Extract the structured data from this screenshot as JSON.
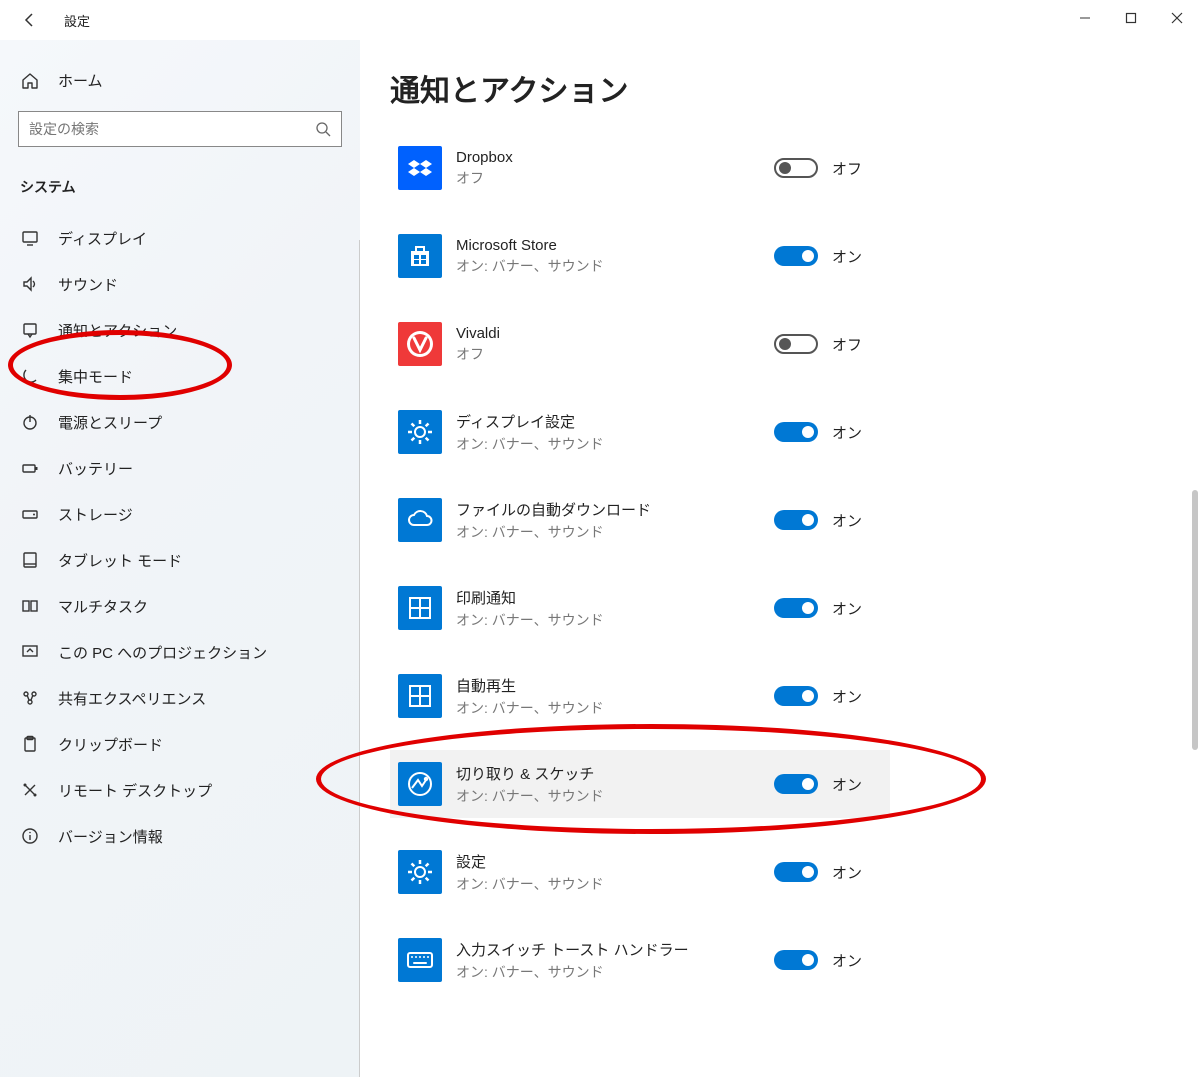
{
  "window": {
    "title": "設定"
  },
  "sidebar": {
    "home": "ホーム",
    "search_placeholder": "設定の検索",
    "section": "システム",
    "items": [
      {
        "icon": "display",
        "label": "ディスプレイ"
      },
      {
        "icon": "sound",
        "label": "サウンド"
      },
      {
        "icon": "notification",
        "label": "通知とアクション"
      },
      {
        "icon": "focus",
        "label": "集中モード"
      },
      {
        "icon": "power",
        "label": "電源とスリープ"
      },
      {
        "icon": "battery",
        "label": "バッテリー"
      },
      {
        "icon": "storage",
        "label": "ストレージ"
      },
      {
        "icon": "tablet",
        "label": "タブレット モード"
      },
      {
        "icon": "multitask",
        "label": "マルチタスク"
      },
      {
        "icon": "project",
        "label": "この PC へのプロジェクション"
      },
      {
        "icon": "share",
        "label": "共有エクスペリエンス"
      },
      {
        "icon": "clipboard",
        "label": "クリップボード"
      },
      {
        "icon": "remote",
        "label": "リモート デスクトップ"
      },
      {
        "icon": "about",
        "label": "バージョン情報"
      }
    ]
  },
  "page": {
    "title": "通知とアクション",
    "on_label": "オン",
    "off_label": "オフ",
    "status_on": "オン: バナー、サウンド",
    "status_off": "オフ",
    "apps": [
      {
        "icon": "dropbox",
        "bg": "#0061fe",
        "name": "Dropbox",
        "on": false,
        "highlighted": false
      },
      {
        "icon": "store",
        "bg": "#0078d4",
        "name": "Microsoft Store",
        "on": true,
        "highlighted": false
      },
      {
        "icon": "vivaldi",
        "bg": "#ef3939",
        "name": "Vivaldi",
        "on": false,
        "highlighted": false
      },
      {
        "icon": "gear",
        "bg": "#0078d4",
        "name": "ディスプレイ設定",
        "on": true,
        "highlighted": false
      },
      {
        "icon": "cloud",
        "bg": "#0078d4",
        "name": "ファイルの自動ダウンロード",
        "on": true,
        "highlighted": false
      },
      {
        "icon": "grid",
        "bg": "#0078d4",
        "name": "印刷通知",
        "on": true,
        "highlighted": false
      },
      {
        "icon": "grid",
        "bg": "#0078d4",
        "name": "自動再生",
        "on": true,
        "highlighted": false
      },
      {
        "icon": "snip",
        "bg": "#0078d4",
        "name": "切り取り & スケッチ",
        "on": true,
        "highlighted": true
      },
      {
        "icon": "gear",
        "bg": "#0078d4",
        "name": "設定",
        "on": true,
        "highlighted": false
      },
      {
        "icon": "keyboard",
        "bg": "#0078d4",
        "name": "入力スイッチ トースト ハンドラー",
        "on": true,
        "highlighted": false
      }
    ]
  }
}
